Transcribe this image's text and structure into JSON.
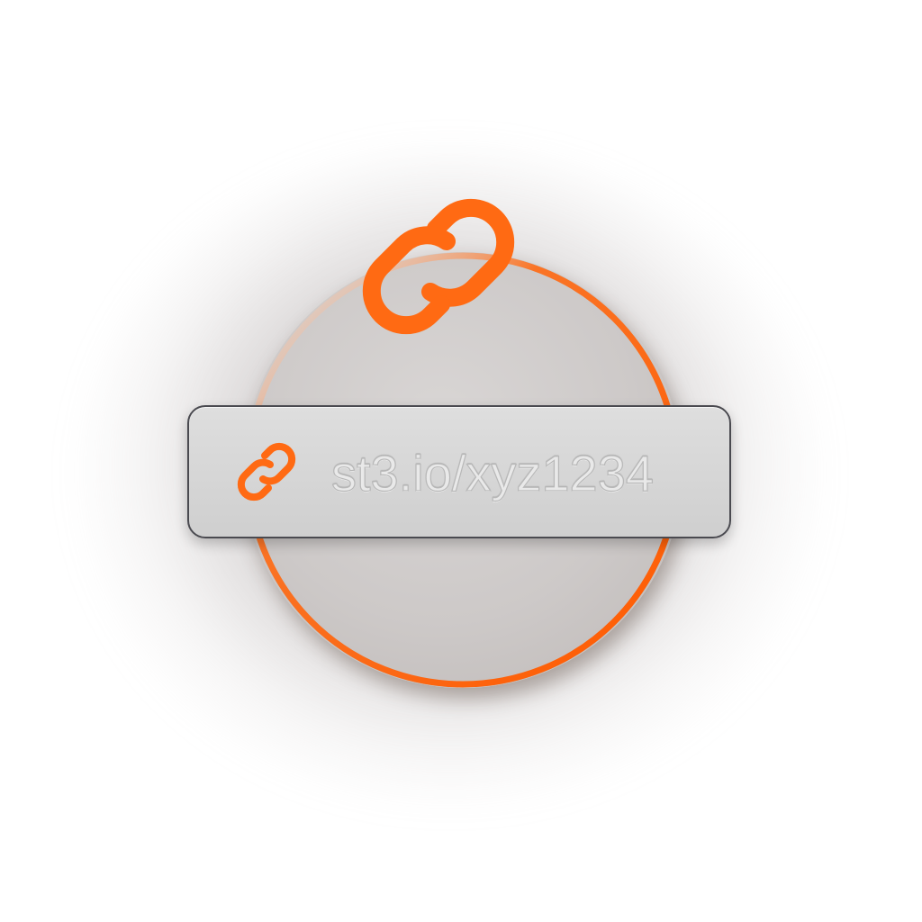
{
  "url_bar": {
    "url_text": "st3.io/xyz1234",
    "icon": "link-icon"
  },
  "hero_icon": "link-chain-icon",
  "colors": {
    "accent": "#ff6a13",
    "bar_border": "#4a4a50",
    "disc": "#cdc9c8"
  }
}
